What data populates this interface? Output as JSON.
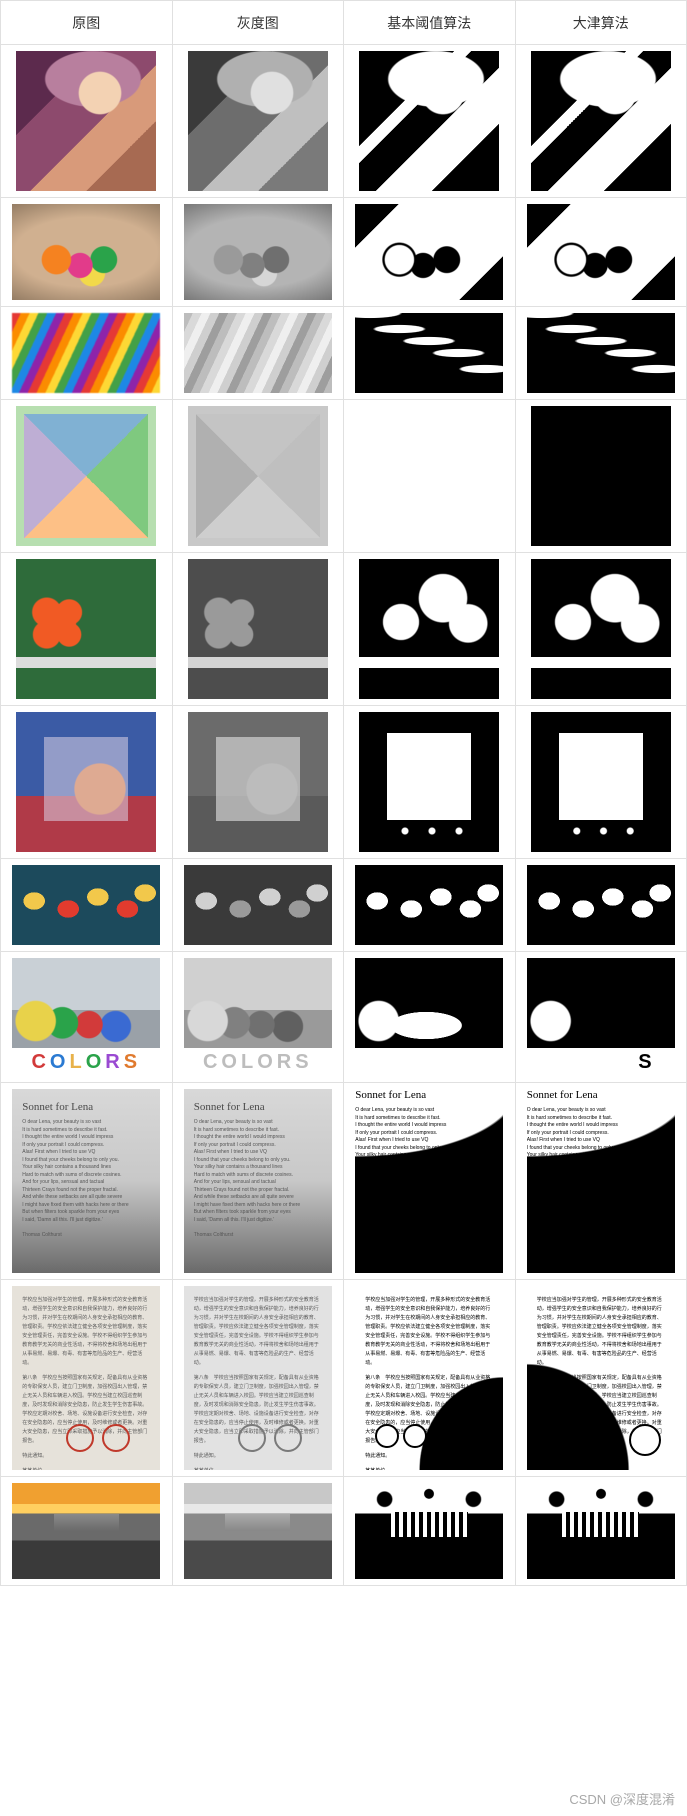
{
  "headers": [
    "原图",
    "灰度图",
    "基本阈值算法",
    "大津算法"
  ],
  "rows": [
    {
      "name": "lena",
      "orig": "lena-color",
      "gray": "lena-gray",
      "th": "lena-bw1",
      "otsu": "lena-bw2",
      "shape": "square"
    },
    {
      "name": "macaron",
      "orig": "macaron-color",
      "gray": "macaron-gray",
      "th": "macaron-bw",
      "otsu": "macaron-bw",
      "shape": "wide"
    },
    {
      "name": "waves",
      "orig": "waves-color",
      "gray": "waves-gray",
      "th": "waves-bw",
      "otsu": "waves-bw",
      "shape": "short"
    },
    {
      "name": "geom",
      "orig": "geom-color",
      "gray": "geom-gray",
      "th": "geom-white white-bg",
      "otsu": "geom-black",
      "shape": "square"
    },
    {
      "name": "flower",
      "orig": "flower-color",
      "gray": "flower-gray",
      "th": "flower-bw",
      "otsu": "flower-bw",
      "shape": "square"
    },
    {
      "name": "abstract",
      "orig": "abstract-color",
      "gray": "abstract-gray",
      "th": "abstract-bw",
      "otsu": "abstract-bw",
      "shape": "square"
    },
    {
      "name": "tulips",
      "orig": "tulips-color",
      "gray": "tulips-gray",
      "th": "tulips-bw",
      "otsu": "tulips-bw",
      "shape": "short"
    }
  ],
  "colors_row": {
    "name": "colors",
    "letters": [
      "C",
      "O",
      "L",
      "O",
      "R",
      "S"
    ]
  },
  "sonnet": {
    "title": "Sonnet for Lena",
    "lines": [
      "O dear Lena, your beauty is so vast",
      "It is hard sometimes to describe it fast.",
      "I thought the entire world I would impress",
      "If only your portrait I could compress.",
      "Alas! First when I tried to use VQ",
      "I found that your cheeks belong to only you.",
      "Your silky hair contains a thousand lines",
      "Hard to match with sums of discrete cosines.",
      "And for your lips, sensual and tactual",
      "Thirteen Crays found not the proper fractal.",
      "And while these setbacks are all quite severe",
      "I might have fixed them with hacks here or there",
      "But when filters took sparkle from your eyes",
      "I said, 'Damn all this. I'll just digitize.'",
      "",
      "Thomas Colthurst"
    ]
  },
  "doc_cn": {
    "paragraphs": [
      "学校应当加强对学生的管理，开展多种形式的安全教育活动，增强学生的安全意识和自我保护能力，培养良好的行为习惯，并对学生在校期间的人身安全承担相应的教育、管理职责。学校应依法建立健全各项安全管理制度，落实安全管理责任，完善安全设施。学校不得组织学生参加与教育教学无关的商业性活动，不得将校舍和场地出租用于从事易燃、易爆、有毒、有害等危险品的生产、经营活动。",
      "第八条　学校应当按照国家有关规定，配备具有从业资格的专职保安人员，建立门卫制度，加强校园出入管理，禁止无关人员和车辆进入校园。学校应当建立校园巡查制度，及时发现和消除安全隐患，防止发生学生伤害事故。学校应定期对校舍、场地、设施设备进行安全检查，对存在安全隐患的，应当停止使用，及时维修或者更换。对重大安全隐患，应当立即采取措施予以消除，并向主管部门报告。",
      "特此通知。"
    ],
    "signature": "某某单位"
  },
  "watermark": "CSDN @深度混淆"
}
